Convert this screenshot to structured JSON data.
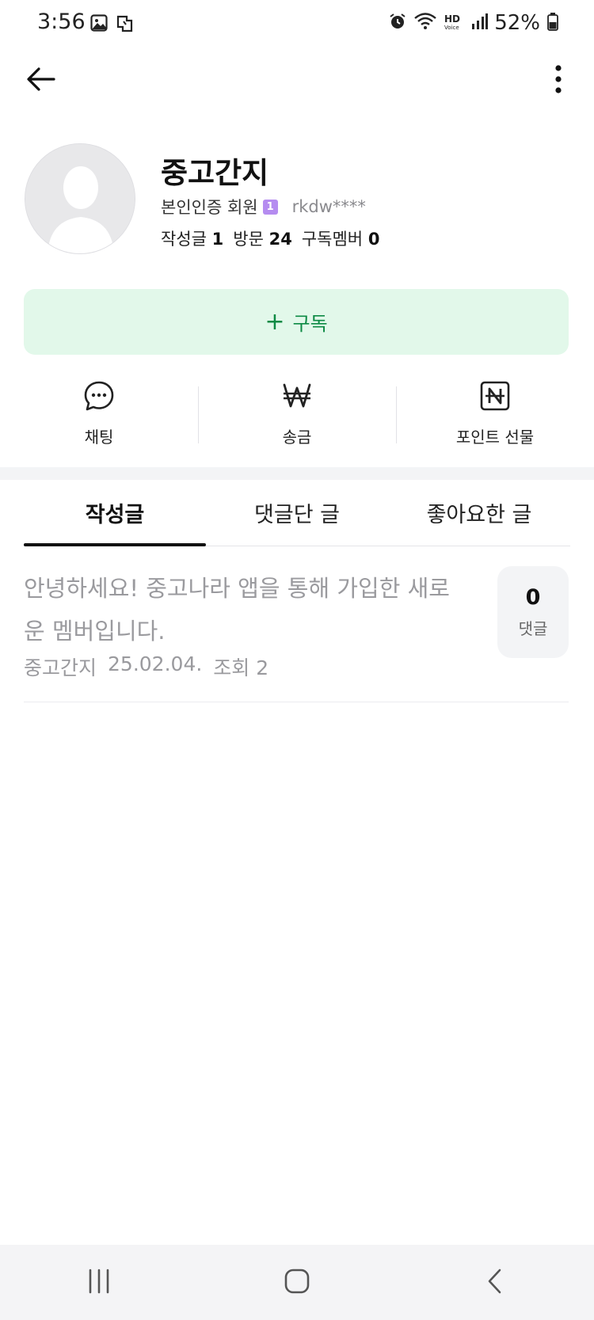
{
  "status_bar": {
    "time": "3:56",
    "battery": "52%",
    "icons": [
      "gallery-icon",
      "nfc-icon",
      "alarm-icon",
      "wifi-icon",
      "hd-voice-icon",
      "signal-icon",
      "battery-icon"
    ]
  },
  "top_bar": {
    "back_icon": "arrow-left-icon",
    "more_icon": "more-vertical-icon"
  },
  "profile": {
    "nickname": "중고간지",
    "member_type": "본인인증 회원",
    "badge": "1",
    "user_id": "rkdw****",
    "stats": [
      {
        "label": "작성글",
        "value": "1"
      },
      {
        "label": "방문",
        "value": "24"
      },
      {
        "label": "구독멤버",
        "value": "0"
      }
    ]
  },
  "subscribe": {
    "plus": "+",
    "label": "구독"
  },
  "actions": [
    {
      "label": "채팅",
      "icon": "chat-icon"
    },
    {
      "label": "송금",
      "icon": "won-icon"
    },
    {
      "label": "포인트 선물",
      "icon": "naver-point-icon"
    }
  ],
  "tabs": [
    {
      "label": "작성글",
      "active": true
    },
    {
      "label": "댓글단 글",
      "active": false
    },
    {
      "label": "좋아요한 글",
      "active": false
    }
  ],
  "posts": [
    {
      "title": "안녕하세요! 중고나라 앱을 통해 가입한 새로운 멤버입니다.",
      "author": "중고간지",
      "date": "25.02.04.",
      "views": "조회 2",
      "comment_count": "0",
      "comment_label": "댓글"
    }
  ],
  "nav_bar": {
    "icons": [
      "recent-apps-icon",
      "home-icon",
      "back-icon"
    ]
  },
  "colors": {
    "subscribe_bg": "#e2f8ea",
    "subscribe_text": "#0d8a44",
    "badge": "#b58cf0"
  }
}
